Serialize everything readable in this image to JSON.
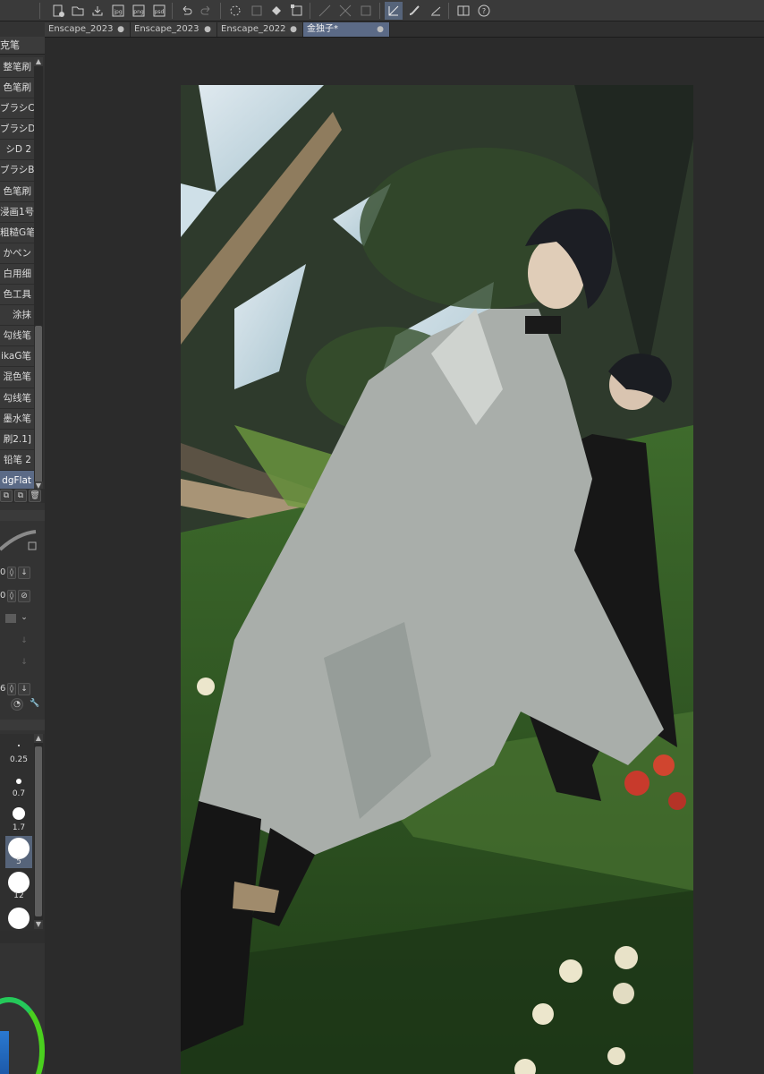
{
  "tabs": [
    {
      "label": "Enscape_2023",
      "active": false
    },
    {
      "label": "Enscape_2023",
      "active": false
    },
    {
      "label": "Enscape_2022",
      "active": false
    },
    {
      "label": "金独子*",
      "active": true
    }
  ],
  "tab_modified_marker": "●",
  "brush_panel": {
    "header": "克笔",
    "items": [
      "整笔刷",
      "色笔刷",
      "ブラシC",
      "ブラシD",
      "シD 2",
      "ブラシB",
      "色笔刷",
      "浸画1号",
      "粗糙G笔",
      "かペン",
      "白用细",
      "色工具",
      "涂抹",
      "勾线笔",
      "ikaG笔",
      "混色笔",
      "勾线笔",
      "墨水笔",
      "刷2.1]",
      "铅笔 2",
      "dgFlat"
    ],
    "selected_index": 20
  },
  "property_values": {
    "v1": "0",
    "v2": "0",
    "v3": "6"
  },
  "brush_sizes": [
    {
      "label": "0.25"
    },
    {
      "label": "0.7"
    },
    {
      "label": "1.7"
    },
    {
      "label": "5",
      "selected": true
    },
    {
      "label": "12"
    },
    {
      "label": ""
    }
  ],
  "colors": {
    "accent": "#5b6a86",
    "ring": "#1ccf3a",
    "main_color": "#2a79d1"
  },
  "icons": [
    "new-file-icon",
    "open-folder-icon",
    "save-icon",
    "export-jpg-icon",
    "export-png-icon",
    "export-psd-icon",
    "undo-icon",
    "redo-icon",
    "loading-icon",
    "clear-icon",
    "fill-icon",
    "transform-icon",
    "ruler-icon",
    "brush-tool-icon",
    "line-icon",
    "panel-icon",
    "help-icon"
  ]
}
